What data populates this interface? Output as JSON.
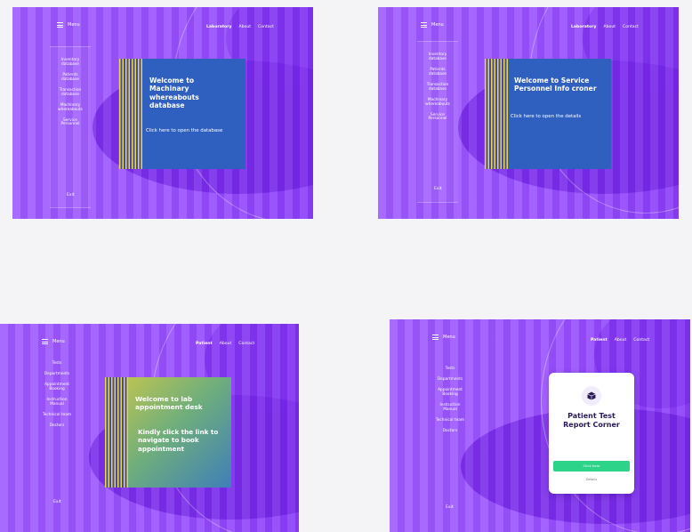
{
  "panels": [
    {
      "menu_label": "Menu",
      "nav": [
        "Laboratory",
        "About",
        "Contact"
      ],
      "side_items": [
        "Inventory database",
        "Patients database",
        "Transaction database",
        "Machinary whereabouts",
        "Service Personnel"
      ],
      "exit": "Exit",
      "card": {
        "title": "Welcome to Machinary whereabouts database",
        "link": "Click here to open the database"
      }
    },
    {
      "menu_label": "Menu",
      "nav": [
        "Laboratory",
        "About",
        "Contact"
      ],
      "side_items": [
        "Inventory database",
        "Patients database",
        "Transaction database",
        "Machinary whereabouts",
        "Service Personnel"
      ],
      "exit": "Exit",
      "card": {
        "title": "Welcome to Service Personnel Info croner",
        "link": "Click here to open the details"
      }
    },
    {
      "menu_label": "Menu",
      "nav": [
        "Patient",
        "About",
        "Contact"
      ],
      "side_items": [
        "Tests",
        "Departments",
        "Appointment Booking",
        "Instruction Manual",
        "Technical team",
        "Doctors"
      ],
      "exit": "Exit",
      "card": {
        "title": "Welcome to lab appointment desk",
        "link": "Kindly click the link to navigate to book appointment"
      }
    },
    {
      "menu_label": "Menu",
      "nav": [
        "Patient",
        "About",
        "Contact"
      ],
      "side_items": [
        "Tests",
        "Departments",
        "Appointment Booking",
        "Instruction Manual",
        "Technical team",
        "Doctors"
      ],
      "exit": "Exit",
      "login": {
        "title": "Patient Test Report Corner",
        "button": "Click here",
        "sub": "Details"
      }
    }
  ],
  "colors": {
    "accent": "#9a52ff",
    "card_blue": "#2f5fbf",
    "button_green": "#2ed38a"
  }
}
